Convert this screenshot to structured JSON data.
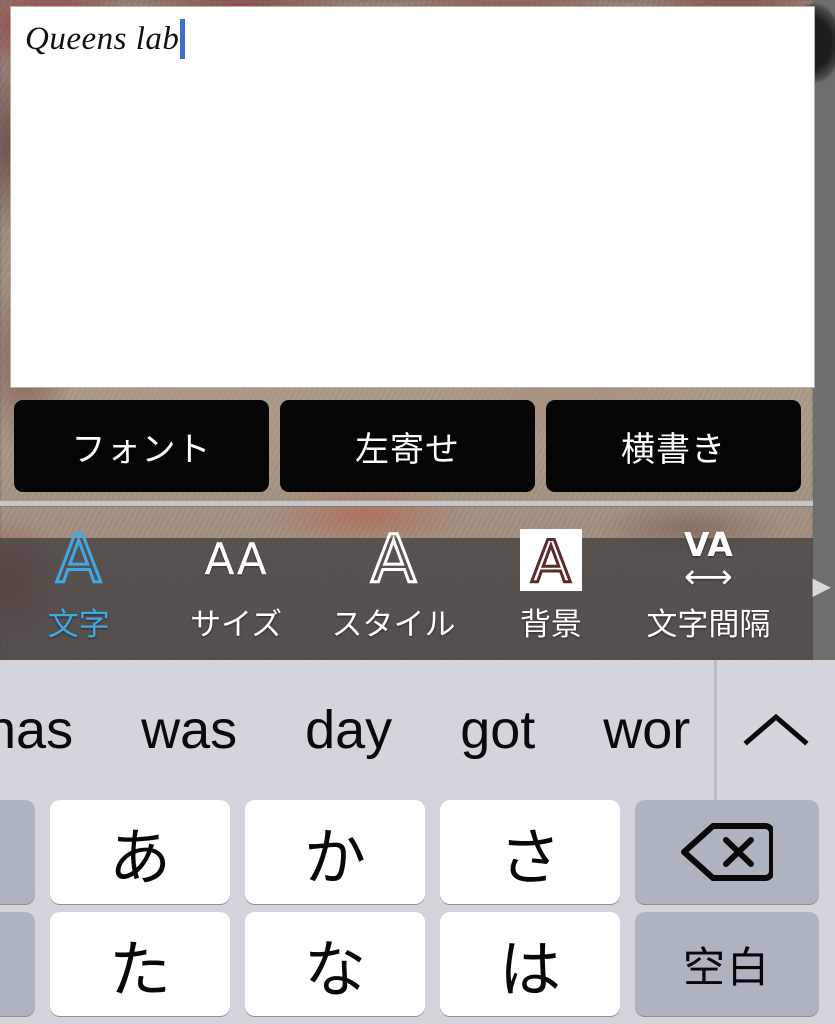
{
  "editor": {
    "text": "Queens lab",
    "caret": "text-cursor"
  },
  "option_buttons": [
    {
      "label": "フォント",
      "name": "font-button"
    },
    {
      "label": "左寄せ",
      "name": "align-left-button"
    },
    {
      "label": "横書き",
      "name": "writing-direction-button"
    }
  ],
  "icon_toolbar": {
    "items": [
      {
        "label": "文字",
        "glyph": "A",
        "icon": "letter-a-outline-icon",
        "active": true
      },
      {
        "label": "サイズ",
        "glyph": "AA",
        "icon": "double-a-size-icon",
        "active": false
      },
      {
        "label": "スタイル",
        "glyph": "A",
        "icon": "letter-a-style-icon",
        "active": false
      },
      {
        "label": "背景",
        "glyph": "A",
        "icon": "letter-a-background-icon",
        "active": false
      },
      {
        "label": "文字間隔",
        "glyph": "VA",
        "icon": "letter-spacing-icon",
        "active": false
      }
    ],
    "more_arrow": "▶",
    "active_color": "#3fa9e8"
  },
  "keyboard": {
    "suggestions": [
      "has",
      "was",
      "day",
      "got",
      "wor"
    ],
    "toggle_icon": "chevron-up-icon",
    "rows": [
      {
        "edge_key": {
          "label": "",
          "style": "gray"
        },
        "keys": [
          {
            "label": "あ",
            "style": "white",
            "name": "key-a"
          },
          {
            "label": "か",
            "style": "white",
            "name": "key-ka"
          },
          {
            "label": "さ",
            "style": "white",
            "name": "key-sa"
          }
        ],
        "func_key": {
          "label": "",
          "style": "gray",
          "icon": "backspace-icon",
          "name": "backspace-key"
        }
      },
      {
        "edge_key": {
          "label": "",
          "style": "gray"
        },
        "keys": [
          {
            "label": "た",
            "style": "white",
            "name": "key-ta"
          },
          {
            "label": "な",
            "style": "white",
            "name": "key-na"
          },
          {
            "label": "は",
            "style": "white",
            "name": "key-ha"
          }
        ],
        "func_key": {
          "label": "空白",
          "style": "gray",
          "icon": "",
          "name": "space-key"
        }
      }
    ]
  },
  "colors": {
    "caret": "#3b6fd4",
    "accent": "#3fa9e8",
    "button_bg": "#050505",
    "keyboard_bg": "#d2d5dc",
    "key_white": "#ffffff",
    "key_gray": "#aeb3c0"
  }
}
